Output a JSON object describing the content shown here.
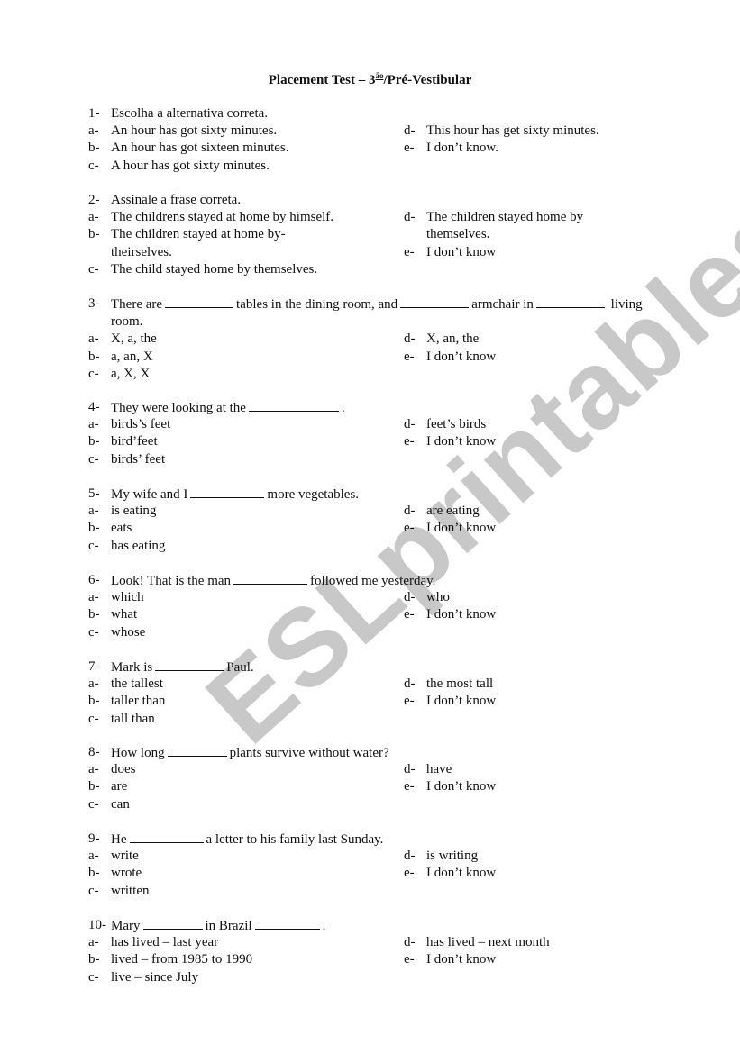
{
  "watermark": "ESLprintables.com",
  "title": {
    "prefix": "Placement Test – 3",
    "superscript": "ão",
    "suffix": "/Pré-Vestibular"
  },
  "questions": [
    {
      "number": "1-",
      "stem_parts": [
        "Escolha a alternativa correta."
      ],
      "options": {
        "a": "An hour has got sixty minutes.",
        "b": "An hour has got sixteen minutes.",
        "c": "A hour has got sixty minutes.",
        "d": "This hour has get sixty minutes.",
        "e": "I don’t know."
      }
    },
    {
      "number": "2-",
      "stem_parts": [
        "Assinale a frase correta."
      ],
      "options": {
        "a": "The childrens stayed at home by himself.",
        "b": "The children stayed at home by-theirselves.",
        "c": "The child stayed home by themselves.",
        "d": "The children stayed home by themselves.",
        "e": "I don’t know"
      }
    },
    {
      "number": "3-",
      "stem_parts": [
        "There are",
        "tables in the dining room, and",
        "armchair in",
        "living room."
      ],
      "options": {
        "a": "X, a, the",
        "b": "a, an, X",
        "c": "a, X, X",
        "d": "X, an, the",
        "e": "I don’t know"
      }
    },
    {
      "number": "4-",
      "stem_parts": [
        "They were looking at the",
        "."
      ],
      "options": {
        "a": "birds’s feet",
        "b": "bird’feet",
        "c": "birds’ feet",
        "d": "feet’s birds",
        "e": "I don’t know"
      }
    },
    {
      "number": "5-",
      "stem_parts": [
        "My wife and I",
        "more vegetables."
      ],
      "options": {
        "a": "is eating",
        "b": "eats",
        "c": "has eating",
        "d": "are eating",
        "e": "I don’t know"
      }
    },
    {
      "number": "6-",
      "stem_parts": [
        "Look! That is the man",
        "followed me yesterday."
      ],
      "options": {
        "a": "which",
        "b": "what",
        "c": "whose",
        "d": "who",
        "e": "I don’t know"
      }
    },
    {
      "number": "7-",
      "stem_parts": [
        "Mark is",
        "Paul."
      ],
      "options": {
        "a": "the tallest",
        "b": "taller than",
        "c": "tall than",
        "d": "the most tall",
        "e": "I don’t know"
      }
    },
    {
      "number": "8-",
      "stem_parts": [
        "How long",
        "plants survive without water?"
      ],
      "options": {
        "a": "does",
        "b": "are",
        "c": "can",
        "d": "have",
        "e": "I don’t know"
      }
    },
    {
      "number": "9-",
      "stem_parts": [
        "He",
        "a letter to his family last Sunday."
      ],
      "options": {
        "a": "write",
        "b": "wrote",
        "c": "written",
        "d": "is writing",
        "e": "I don’t know"
      }
    },
    {
      "number": "10-",
      "stem_parts": [
        "Mary",
        "in Brazil",
        "."
      ],
      "options": {
        "a": "has lived – last year",
        "b": "lived – from 1985 to 1990",
        "c": "live – since July",
        "d": "has lived – next month",
        "e": "I don’t know"
      }
    }
  ],
  "option_letters": {
    "a": "a-",
    "b": "b-",
    "c": "c-",
    "d": "d-",
    "e": "e-"
  }
}
